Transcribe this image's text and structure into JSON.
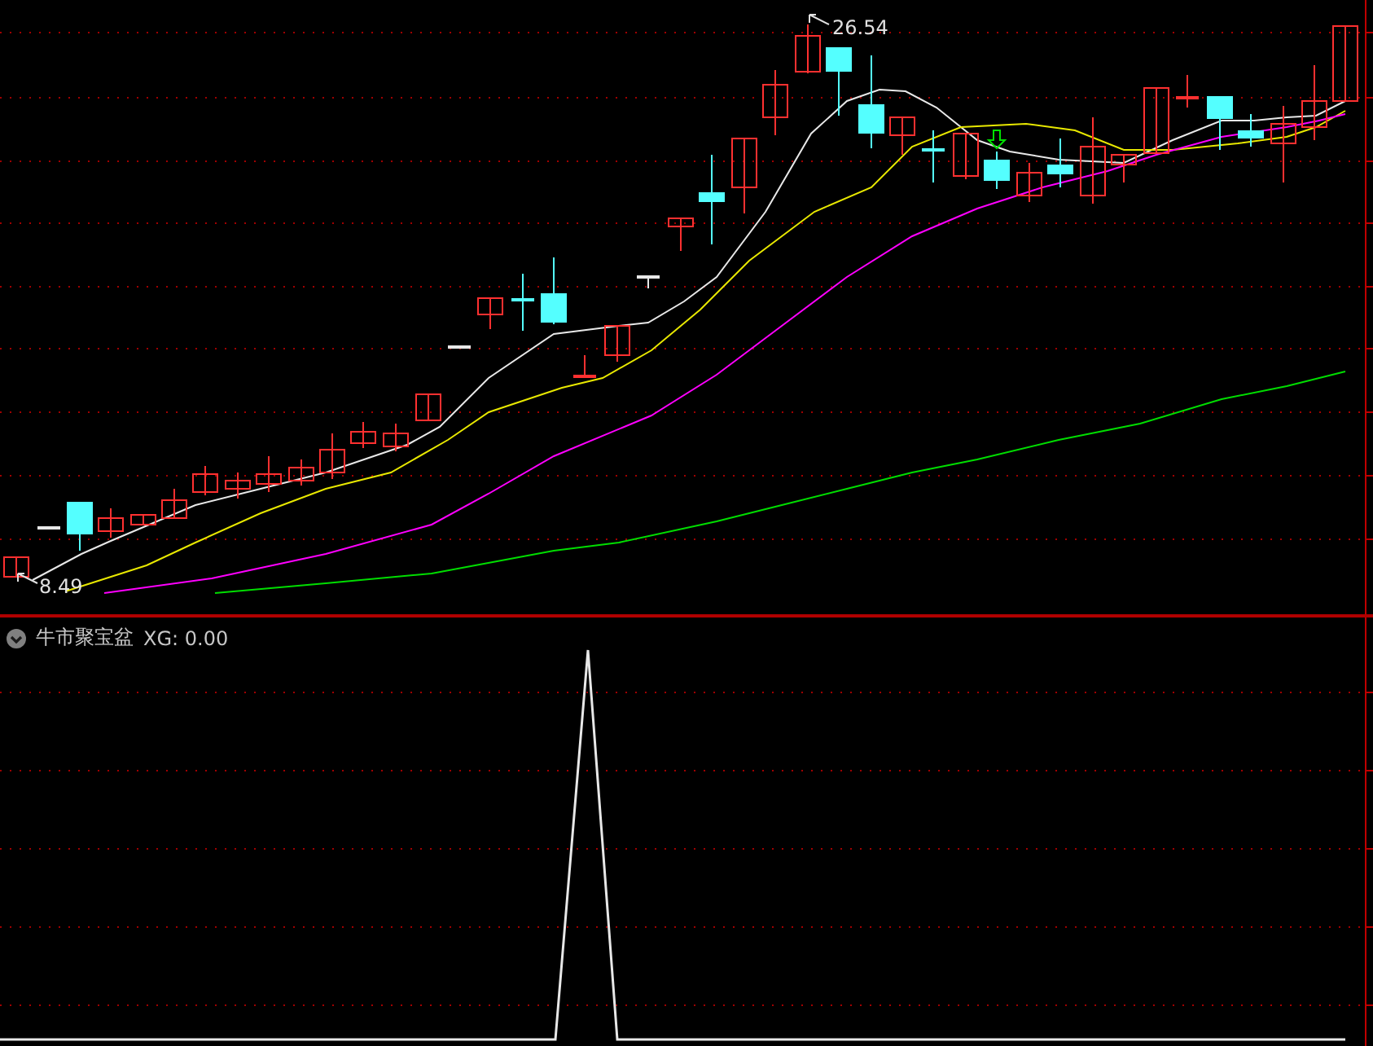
{
  "price_panel": {
    "high_label": "26.54",
    "low_label": "8.49"
  },
  "indicator_panel": {
    "name": "牛市聚宝盆",
    "reading": "XG: 0.00"
  }
}
